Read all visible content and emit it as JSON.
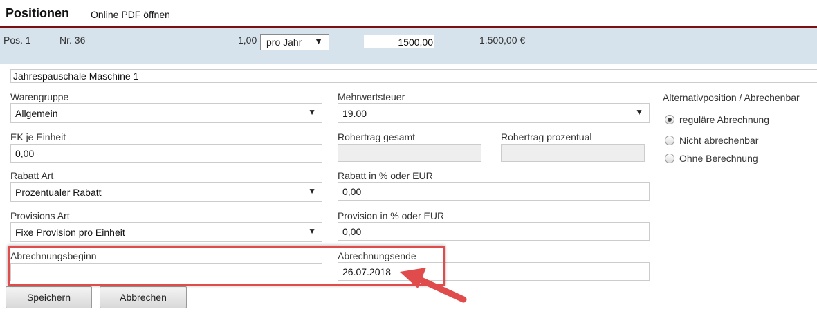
{
  "header": {
    "title": "Positionen",
    "pdf_link": "Online PDF öffnen"
  },
  "position": {
    "pos": "Pos. 1",
    "nr": "Nr. 36",
    "quantity": "1,00",
    "unit": "pro Jahr",
    "price_input": "1500,00",
    "total": "1.500,00 €"
  },
  "description": "Jahrespauschale Maschine 1",
  "form": {
    "warengruppe": {
      "label": "Warengruppe",
      "value": "Allgemein"
    },
    "mehrwertsteuer": {
      "label": "Mehrwertsteuer",
      "value": "19.00"
    },
    "ek": {
      "label": "EK je Einheit",
      "value": "0,00"
    },
    "rohertrag_gesamt": {
      "label": "Rohertrag gesamt",
      "value": ""
    },
    "rohertrag_prozentual": {
      "label": "Rohertrag prozentual",
      "value": ""
    },
    "rabatt_art": {
      "label": "Rabatt Art",
      "value": "Prozentualer Rabatt"
    },
    "rabatt_wert": {
      "label": "Rabatt in % oder EUR",
      "value": "0,00"
    },
    "provisions_art": {
      "label": "Provisions Art",
      "value": "Fixe Provision pro Einheit"
    },
    "provision_wert": {
      "label": "Provision in % oder EUR",
      "value": "0,00"
    },
    "abrechnungsbeginn": {
      "label": "Abrechnungsbeginn",
      "value": ""
    },
    "abrechnungsende": {
      "label": "Abrechnungsende",
      "value": "26.07.2018"
    }
  },
  "billing": {
    "label": "Alternativposition / Abrechenbar",
    "options": [
      {
        "label": "reguläre Abrechnung",
        "checked": true
      },
      {
        "label": "Nicht abrechenbar",
        "checked": false
      },
      {
        "label": "Ohne Berechnung",
        "checked": false
      }
    ]
  },
  "buttons": {
    "save": "Speichern",
    "cancel": "Abbrechen"
  },
  "colors": {
    "header_rule": "#7a1010",
    "position_row": "#d6e3ec",
    "annotation": "#e04b4b"
  },
  "icons": {
    "dropdown": "triangle-down-icon",
    "annotation": "red-arrow-icon"
  }
}
